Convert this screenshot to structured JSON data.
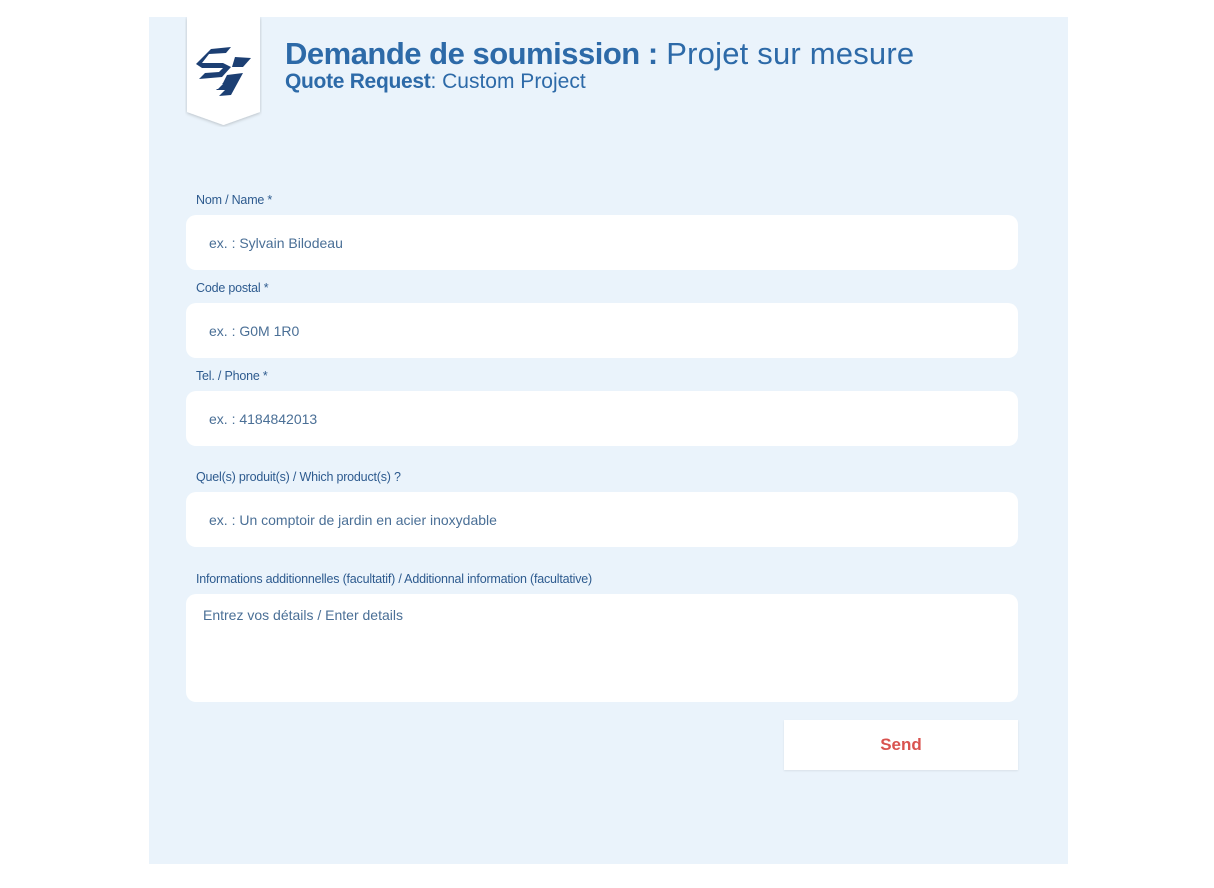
{
  "header": {
    "title_fr_bold": "Demande de soumission :",
    "title_fr_light": "Projet sur mesure",
    "title_en_bold": "Quote Request",
    "title_en_light": ": Custom Project"
  },
  "form": {
    "name": {
      "label": "Nom / Name *",
      "placeholder": "ex. : Sylvain Bilodeau",
      "value": ""
    },
    "postal": {
      "label": "Code postal *",
      "placeholder": "ex. : G0M 1R0",
      "value": ""
    },
    "phone": {
      "label": "Tel. / Phone *",
      "placeholder": "ex. : 4184842013",
      "value": ""
    },
    "products": {
      "label": "Quel(s) produit(s) / Which product(s) ?",
      "placeholder": "ex. : Un comptoir de jardin en acier inoxydable",
      "value": ""
    },
    "details": {
      "label": "Informations additionnelles (facultatif) / Additionnal information (facultative)",
      "placeholder": "Entrez vos détails / Enter details",
      "value": ""
    },
    "send_label": "Send"
  },
  "colors": {
    "panel_bg": "#eaf3fb",
    "brand_blue": "#2d6aa8",
    "label_blue": "#2e5b8f",
    "logo_navy": "#1c3f73",
    "send_red": "#d9534f"
  },
  "icons": {
    "logo": "logo-icon"
  }
}
